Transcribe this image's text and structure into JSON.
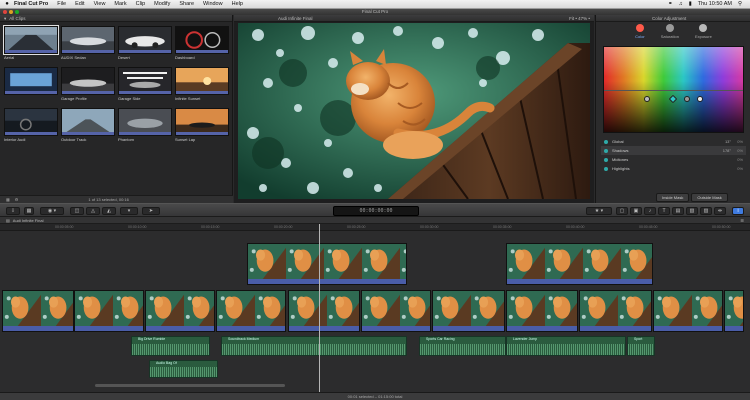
{
  "menubar": {
    "apple": "",
    "app_name": "Final Cut Pro",
    "items": [
      "File",
      "Edit",
      "View",
      "Mark",
      "Clip",
      "Modify",
      "Share",
      "Window",
      "Help"
    ],
    "clock": "Thu 10:50 AM"
  },
  "window": {
    "title": "Final Cut Pro"
  },
  "browser": {
    "header": "All Clips",
    "clips": [
      {
        "label": "Aerial",
        "scene": "dark-road",
        "selected": true
      },
      {
        "label": "AUDIX Sedan",
        "scene": "car"
      },
      {
        "label": "Desert",
        "scene": "car-white"
      },
      {
        "label": "Dashboard",
        "scene": "dashboard"
      },
      {
        "label": "",
        "scene": "interior-blue"
      },
      {
        "label": "Garage Profile",
        "scene": "garage"
      },
      {
        "label": "Garage Side",
        "scene": "garage-lights"
      },
      {
        "label": "Infinite Sunset",
        "scene": "sunset"
      },
      {
        "label": "Interior Audi",
        "scene": "interior"
      },
      {
        "label": "Outdoor Track",
        "scene": "track"
      },
      {
        "label": "Phantom",
        "scene": "car-gray"
      },
      {
        "label": "Sunset Lap",
        "scene": "sunset-car"
      }
    ],
    "status": "1 of 13 selected, 00:16"
  },
  "viewer": {
    "title": "Audi Infinite Final",
    "zoom": "Fit • 47% •"
  },
  "inspector": {
    "title": "Color Adjustment",
    "tabs": [
      {
        "label": "Color",
        "color": "#ff5a4a"
      },
      {
        "label": "Saturation",
        "color": "#9a9a9a"
      },
      {
        "label": "Exposure",
        "color": "#b8b8b8"
      }
    ],
    "active_tab": "Color",
    "rows": [
      {
        "label": "Global",
        "value": "13°",
        "spin": "0%"
      },
      {
        "label": "Shadows",
        "value": "178°",
        "spin": "0%",
        "selected": true
      },
      {
        "label": "Midtones",
        "value": "",
        "spin": "0%"
      },
      {
        "label": "Highlights",
        "value": "",
        "spin": "0%"
      }
    ],
    "mask_buttons": [
      "Inside Mask",
      "Outside Mask"
    ]
  },
  "toolbar": {
    "timecode": "00:00:00:00"
  },
  "timeline": {
    "project": "Audi Infinite Final",
    "ruler_labels": [
      "00:00:05:00",
      "00:00:10:00",
      "00:00:15:00",
      "00:00:20:00",
      "00:00:25:00",
      "00:00:30:00",
      "00:00:35:00",
      "00:00:40:00",
      "00:00:45:00",
      "00:00:50:00"
    ],
    "audio_clips": [
      "Big Drive Rumble",
      "Soundtrack Medium",
      "Sports Car Racing",
      "Lavender Jump",
      "Sport",
      "Audio Bag Of"
    ],
    "footer": "00:01 selected – 01:15:00 total"
  }
}
